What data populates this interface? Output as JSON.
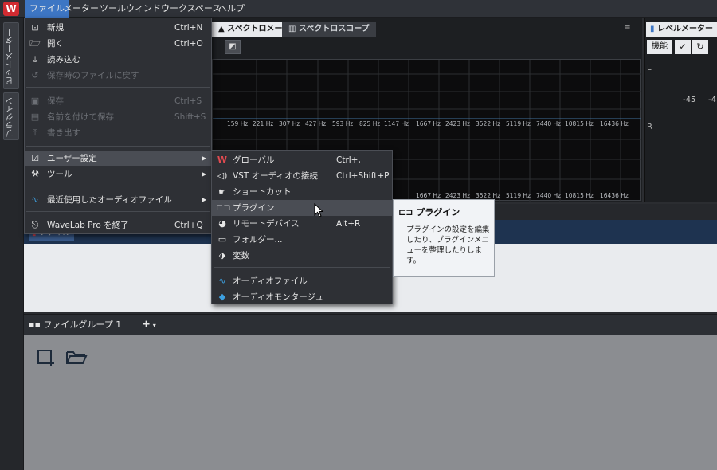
{
  "menubar": {
    "items": [
      "ファイル",
      "メーター",
      "ツールウィンドウ",
      "ワークスペース",
      "ヘルプ"
    ]
  },
  "left_strip": {
    "tabs": [
      "ビットメーター",
      "プラグイン"
    ]
  },
  "spectrum": {
    "tabs": [
      "スペクトロメーター",
      "スペクトロスコープ"
    ],
    "freq_labels": [
      "159 Hz",
      "221 Hz",
      "307 Hz",
      "427 Hz",
      "593 Hz",
      "825 Hz",
      "1147 Hz",
      "1667 Hz",
      "2423 Hz",
      "3522 Hz",
      "5119 Hz",
      "7440 Hz",
      "10815 Hz",
      "16436 Hz"
    ]
  },
  "level_meter": {
    "tab": "レベルメーター",
    "func_label": "機能",
    "ch_left": "L",
    "ch_right": "R",
    "db_a": "-45",
    "db_b": "-4"
  },
  "files": {
    "tab": "ファイル"
  },
  "group": {
    "tab": "ファイルグループ 1",
    "add": "+"
  },
  "file_menu": {
    "items": [
      {
        "icon": "new-file-icon",
        "label": "新規",
        "shortcut": "Ctrl+N",
        "disabled": false
      },
      {
        "icon": "open-folder-icon",
        "label": "開く",
        "shortcut": "Ctrl+O",
        "disabled": false
      },
      {
        "icon": "import-icon",
        "label": "読み込む",
        "shortcut": "",
        "disabled": false
      },
      {
        "icon": "revert-icon",
        "label": "保存時のファイルに戻す",
        "shortcut": "",
        "disabled": true
      },
      {
        "icon": "save-icon",
        "label": "保存",
        "shortcut": "Ctrl+S",
        "disabled": true
      },
      {
        "icon": "save-as-icon",
        "label": "名前を付けて保存",
        "shortcut": "Shift+S",
        "disabled": true
      },
      {
        "icon": "export-icon",
        "label": "書き出す",
        "shortcut": "",
        "disabled": true
      },
      {
        "icon": "preferences-icon",
        "label": "ユーザー設定",
        "shortcut": "",
        "disabled": false
      },
      {
        "icon": "tools-icon",
        "label": "ツール",
        "shortcut": "",
        "disabled": false
      },
      {
        "icon": "recent-audio-icon",
        "label": "最近使用したオーディオファイル",
        "shortcut": "",
        "disabled": false
      },
      {
        "icon": "exit-icon",
        "label": "WaveLab Pro を終了",
        "shortcut": "Ctrl+Q",
        "disabled": false
      }
    ]
  },
  "submenu": {
    "items": [
      {
        "icon": "global-icon",
        "label": "グローバル",
        "shortcut": "Ctrl+,"
      },
      {
        "icon": "vst-audio-icon",
        "label": "VST オーディオの接続",
        "shortcut": "Ctrl+Shift+P"
      },
      {
        "icon": "shortcut-icon",
        "label": "ショートカット",
        "shortcut": ""
      },
      {
        "icon": "plugin-icon",
        "label": "プラグイン",
        "shortcut": ""
      },
      {
        "icon": "remote-device-icon",
        "label": "リモートデバイス",
        "shortcut": "Alt+R"
      },
      {
        "icon": "folder-icon",
        "label": "フォルダー...",
        "shortcut": ""
      },
      {
        "icon": "variables-icon",
        "label": "変数",
        "shortcut": ""
      },
      {
        "icon": "audio-file-icon",
        "label": "オーディオファイル",
        "shortcut": ""
      },
      {
        "icon": "audio-montage-icon",
        "label": "オーディオモンタージュ",
        "shortcut": ""
      }
    ]
  },
  "tooltip": {
    "title": "プラグイン",
    "body": "プラグインの設定を編集したり、プラグインメニューを整理したりします。"
  }
}
